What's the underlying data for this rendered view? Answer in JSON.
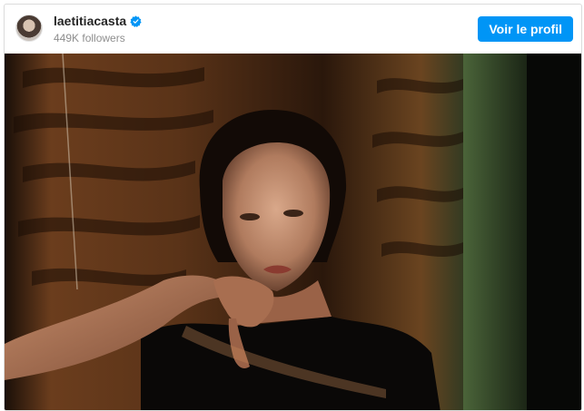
{
  "post": {
    "username": "laetitiacasta",
    "followers": "449K followers",
    "profile_button_label": "Voir le profil"
  },
  "icons": {
    "avatar": "profile-avatar",
    "verified": "verified-badge-icon"
  },
  "colors": {
    "accent": "#0095f6",
    "username": "#262626",
    "secondary_text": "#8e8e8e",
    "border": "#dbdbdb"
  }
}
